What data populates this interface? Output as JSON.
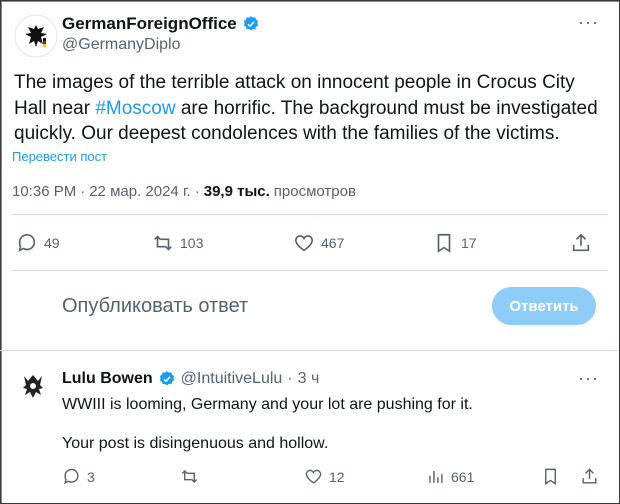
{
  "tweet": {
    "author_name": "GermanForeignOffice",
    "author_handle": "@GermanyDiplo",
    "text_part1": "The images of the terrible attack on innocent people in Crocus City Hall near ",
    "hashtag": "#Moscow",
    "text_part2": " are horrific. The background must be investigated quickly. Our deepest condolences with the families of the victims.",
    "translate_label": "Перевести пост",
    "time": "10:36 PM",
    "date": "22 мар. 2024 г.",
    "views_count": "39,9 тыс.",
    "views_label": "просмотров",
    "separator": "·",
    "replies": "49",
    "reposts": "103",
    "likes": "467",
    "bookmarks": "17"
  },
  "composer": {
    "placeholder": "Опубликовать ответ",
    "reply_button": "Ответить"
  },
  "reply": {
    "author_name": "Lulu Bowen",
    "author_handle": "@IntuitiveLulu",
    "separator": "·",
    "age": "3 ч",
    "line1": "WWIII is looming, Germany and your lot are pushing for it.",
    "line2": "Your post is disingenuous and hollow.",
    "replies": "3",
    "likes": "12",
    "views": "661"
  },
  "colors": {
    "accent": "#1d9bf0",
    "verified": "#1d9bf0",
    "muted": "#536471"
  }
}
